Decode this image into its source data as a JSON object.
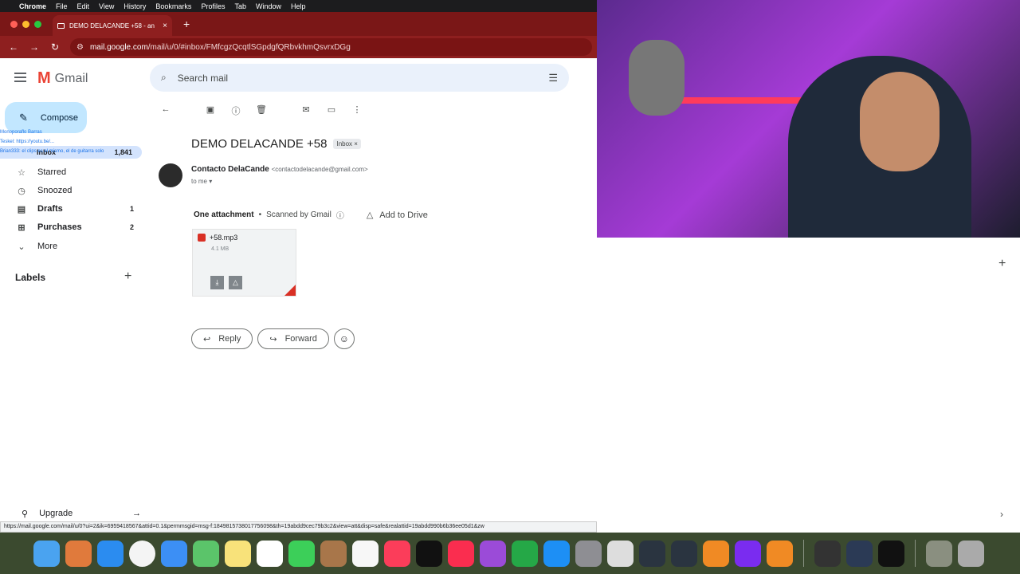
{
  "menubar": {
    "app": "Chrome",
    "items": [
      "File",
      "Edit",
      "View",
      "History",
      "Bookmarks",
      "Profiles",
      "Tab",
      "Window",
      "Help"
    ]
  },
  "browser": {
    "tab_title": "DEMO DELACANDE +58 - an",
    "url_host": "mail.google.com",
    "url_path": "/mail/u/0/#inbox/FMfcgzQcqtlSGpdgfQRbvkhmQsvrxDGg",
    "status_url": "https://mail.google.com/mail/u/0?ui=2&ik=6959418567&attid=0.1&permmsgid=msg-f:1849815738017756098&th=19abdd9cec79b3c2&view=att&disp=safe&realattid=19abdd990b6b36ee05d1&zw"
  },
  "gmail": {
    "logo_text": "Gmail",
    "search_placeholder": "Search mail",
    "compose": "Compose",
    "nav": {
      "inbox": "Inbox",
      "inbox_count": "1,841",
      "starred": "Starred",
      "snoozed": "Snoozed",
      "drafts": "Drafts",
      "drafts_count": "1",
      "purchases": "Purchases",
      "purchases_count": "2",
      "more": "More"
    },
    "labels_heading": "Labels",
    "upgrade": "Upgrade"
  },
  "overlay": {
    "line1": "Monoporaflo Barras",
    "line2": "Teskel: https://youtu.be/...",
    "line3": "Brian333: el clips es el mismo, el de guitarra solo"
  },
  "email": {
    "subject": "DEMO DELACANDE +58",
    "label_badge": "Inbox",
    "sender_name": "Contacto DelaCande",
    "sender_email": "<contactodelacande@gmail.com>",
    "to_me": "to me",
    "attachment_count": "One attachment",
    "scanned": "Scanned by Gmail",
    "add_to_drive": "Add to Drive",
    "file_name": "+58.mp3",
    "file_size": "4.1 MB",
    "reply": "Reply",
    "forward": "Forward"
  }
}
